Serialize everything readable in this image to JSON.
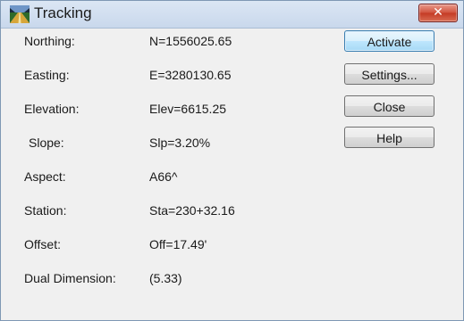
{
  "window": {
    "title": "Tracking",
    "close_glyph": "✕",
    "icon": "road-perspective-icon"
  },
  "fields": [
    {
      "label": "Northing:",
      "value": "N=1556025.65"
    },
    {
      "label": "Easting:",
      "value": "E=3280130.65"
    },
    {
      "label": "Elevation:",
      "value": "Elev=6615.25"
    },
    {
      "label": " Slope:",
      "value": "Slp=3.20%"
    },
    {
      "label": "Aspect:",
      "value": "A66^"
    },
    {
      "label": "Station:",
      "value": "Sta=230+32.16"
    },
    {
      "label": "Offset:",
      "value": "Off=17.49'"
    },
    {
      "label": "Dual Dimension:",
      "value": "(5.33)"
    }
  ],
  "buttons": {
    "activate": "Activate",
    "settings": "Settings...",
    "close": "Close",
    "help": "Help"
  },
  "colors": {
    "default_button": "#bee6fd",
    "close_button": "#c43a24"
  }
}
